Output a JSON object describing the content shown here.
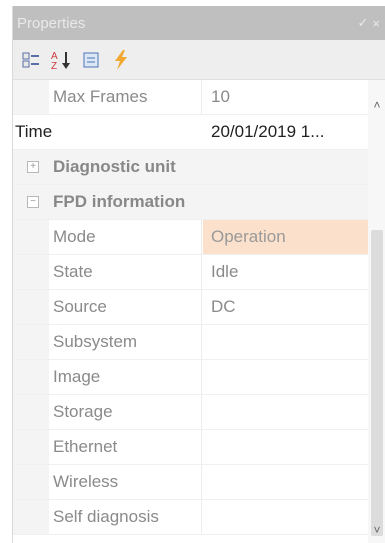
{
  "window": {
    "title": "Properties",
    "pin_glyph": "✓",
    "close_glyph": "×"
  },
  "toolbar": {
    "buttons": [
      {
        "icon": "categorized-icon"
      },
      {
        "icon": "alphabetical-sort-icon"
      },
      {
        "icon": "property-pages-icon"
      },
      {
        "icon": "events-lightning-icon"
      }
    ]
  },
  "rows": [
    {
      "kind": "property",
      "name": "Max Frames",
      "value": "10"
    },
    {
      "kind": "top",
      "name": "Time",
      "value": "20/01/2019 1..."
    },
    {
      "kind": "category",
      "label": "Diagnostic unit",
      "expander": "+"
    },
    {
      "kind": "category",
      "label": "FPD information",
      "expander": "−"
    },
    {
      "kind": "property",
      "name": "Mode",
      "value": "Operation",
      "selected": true
    },
    {
      "kind": "property",
      "name": "State",
      "value": "Idle"
    },
    {
      "kind": "property",
      "name": "Source",
      "value": "DC"
    },
    {
      "kind": "property",
      "name": "Subsystem",
      "value": ""
    },
    {
      "kind": "property",
      "name": "Image",
      "value": ""
    },
    {
      "kind": "property",
      "name": "Storage",
      "value": ""
    },
    {
      "kind": "property",
      "name": "Ethernet",
      "value": ""
    },
    {
      "kind": "property",
      "name": "Wireless",
      "value": ""
    },
    {
      "kind": "property",
      "name": "Self diagnosis",
      "value": ""
    }
  ],
  "scrollbar": {
    "up_glyph": "˄",
    "down_glyph": "˅"
  },
  "colors": {
    "selected_value_bg": "#fbe1cb",
    "titlebar_bg": "#bfbfbf",
    "toolbar_bg": "#eeeeee"
  }
}
